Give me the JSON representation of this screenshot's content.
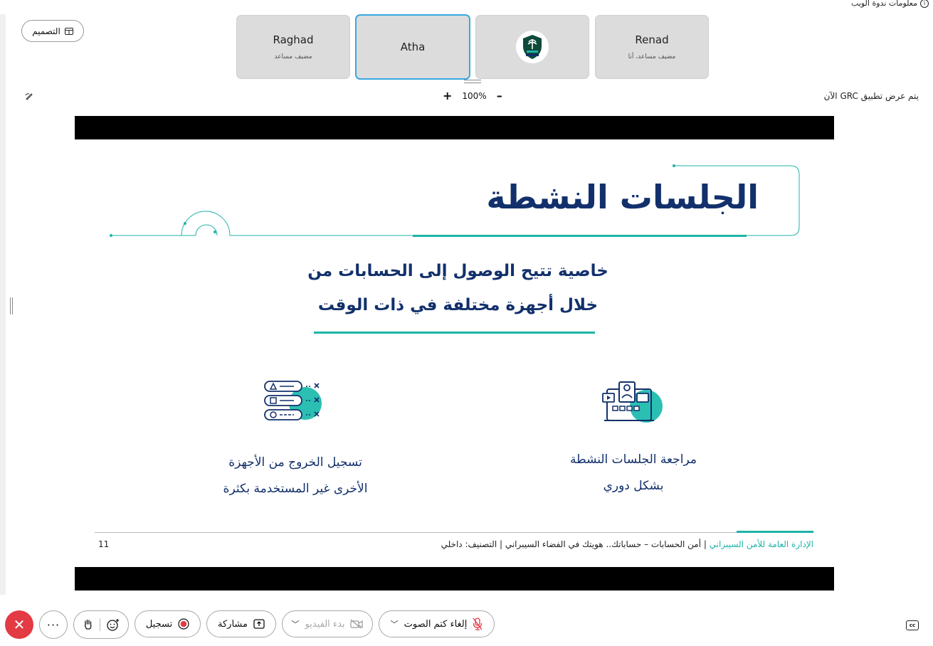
{
  "top": {
    "webinar_info": "معلومات ندوة الويب",
    "layout_label": "التصميم",
    "share_status": "يتم عرض تطبيق GRC الآن",
    "zoom_level": "100%"
  },
  "participants": [
    {
      "name": "Renad",
      "role": "مضيف مساعد، أنا"
    },
    {
      "name": "",
      "role": "",
      "logo_icon": "cyber-security-logo"
    },
    {
      "name": "Atha",
      "role": "",
      "active": true
    },
    {
      "name": "Raghad",
      "role": "مضيف مساعد"
    }
  ],
  "slide": {
    "title": "الجلسات النشطة",
    "subtitle_line1": "خاصية تتيح الوصول إلى الحسابات من",
    "subtitle_line2": "خلال أجهزة مختلفة في ذات الوقت",
    "feature1_line1": "مراجعة الجلسات النشطة",
    "feature1_line2": "بشكل دوري",
    "feature2_line1": "تسجيل الخروج من الأجهزة",
    "feature2_line2": "الأخرى غير المستخدمة بكثرة",
    "footer_org": "الإدارة العامة للأمن السيبراني",
    "footer_rest": " | أمن الحسابات – حساباتك.. هويتك في الفضاء السيبراني | التصنيف: داخلي",
    "page_number": "11",
    "accent_color": "#1eb4a8",
    "text_color": "#12306b"
  },
  "toolbar": {
    "mute_label": "إلغاء كتم الصوت",
    "video_label": "بدء الفيديو",
    "share_label": "مشاركة",
    "record_label": "تسجيل",
    "more_label": "···",
    "cc_label": "cc"
  }
}
